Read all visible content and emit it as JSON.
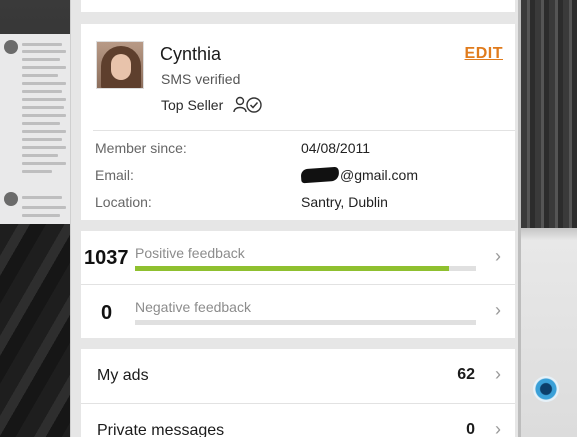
{
  "profile": {
    "name": "Cynthia",
    "verification": "SMS verified",
    "badge": "Top Seller",
    "badge_icon": "seller-check-icon",
    "edit_label": "EDIT"
  },
  "details": [
    {
      "key": "Member since:",
      "value": "04/08/2011"
    },
    {
      "key": "Email:",
      "value": "@gmail.com"
    },
    {
      "key": "Location:",
      "value": "Santry, Dublin"
    }
  ],
  "feedback": {
    "positive": {
      "count": "1037",
      "label": "Positive feedback",
      "fill_fraction": 0.92
    },
    "negative": {
      "count": "0",
      "label": "Negative feedback",
      "fill_fraction": 0.0
    }
  },
  "menu": [
    {
      "label": "My ads",
      "count": "62"
    },
    {
      "label": "Private messages",
      "count": "0"
    }
  ],
  "colors": {
    "accent": "#e07b1c",
    "positive_bar": "#8fc02f",
    "track": "#e0e0e0"
  }
}
